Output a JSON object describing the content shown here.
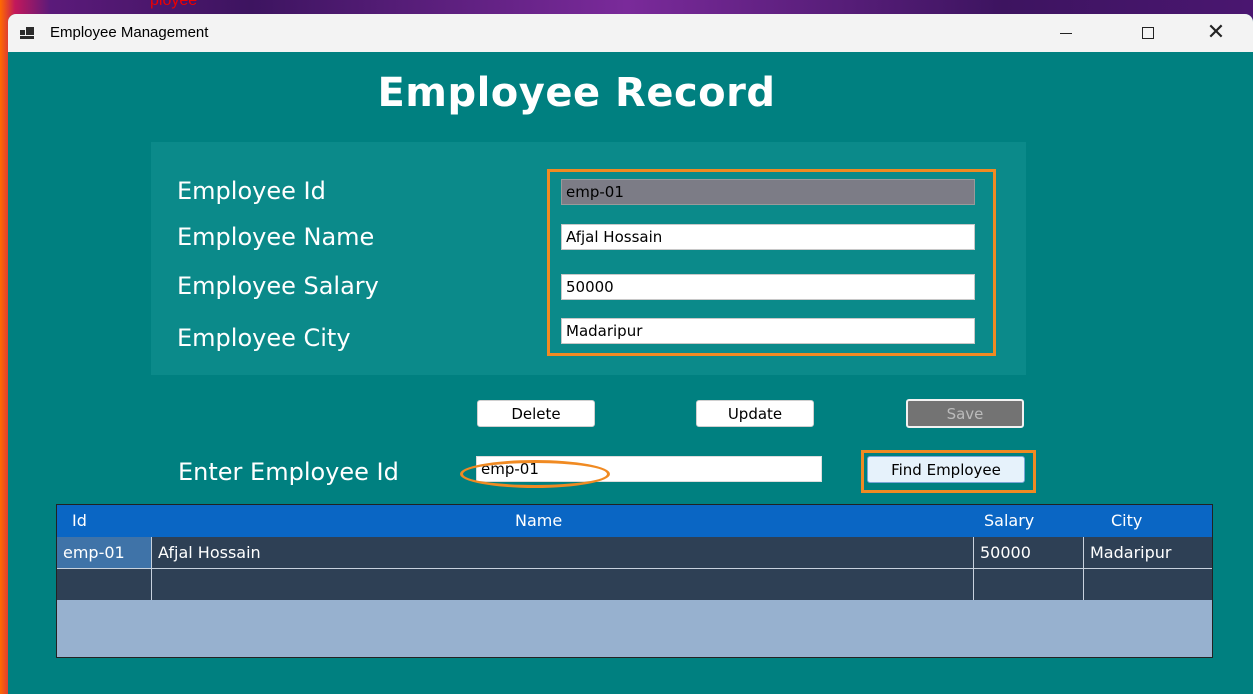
{
  "background": {
    "top_text": "ployee"
  },
  "window": {
    "title": "Employee Management",
    "controls": {
      "minimize": "—",
      "maximize": "",
      "close": "✕"
    }
  },
  "page_title": "Employee Record",
  "form": {
    "fields": [
      {
        "label": "Employee Id",
        "value": "emp-01",
        "readonly": true
      },
      {
        "label": "Employee Name",
        "value": "Afjal Hossain"
      },
      {
        "label": "Employee Salary",
        "value": "50000"
      },
      {
        "label": "Employee City",
        "value": "Madaripur"
      }
    ]
  },
  "buttons": {
    "delete": "Delete",
    "update": "Update",
    "save": "Save"
  },
  "search": {
    "label": "Enter Employee Id",
    "value": "emp-01",
    "find_button": "Find Employee"
  },
  "grid": {
    "columns": [
      "Id",
      "Name",
      "Salary",
      "City"
    ],
    "rows": [
      {
        "id": "emp-01",
        "name": "Afjal Hossain",
        "salary": "50000",
        "city": "Madaripur"
      },
      {
        "id": "",
        "name": "",
        "salary": "",
        "city": ""
      }
    ]
  },
  "colors": {
    "form_bg": "#008080",
    "highlight": "#f08a22",
    "grid_header": "#0a66c4",
    "grid_row": "#2e4055",
    "grid_empty": "#97b1cf"
  }
}
